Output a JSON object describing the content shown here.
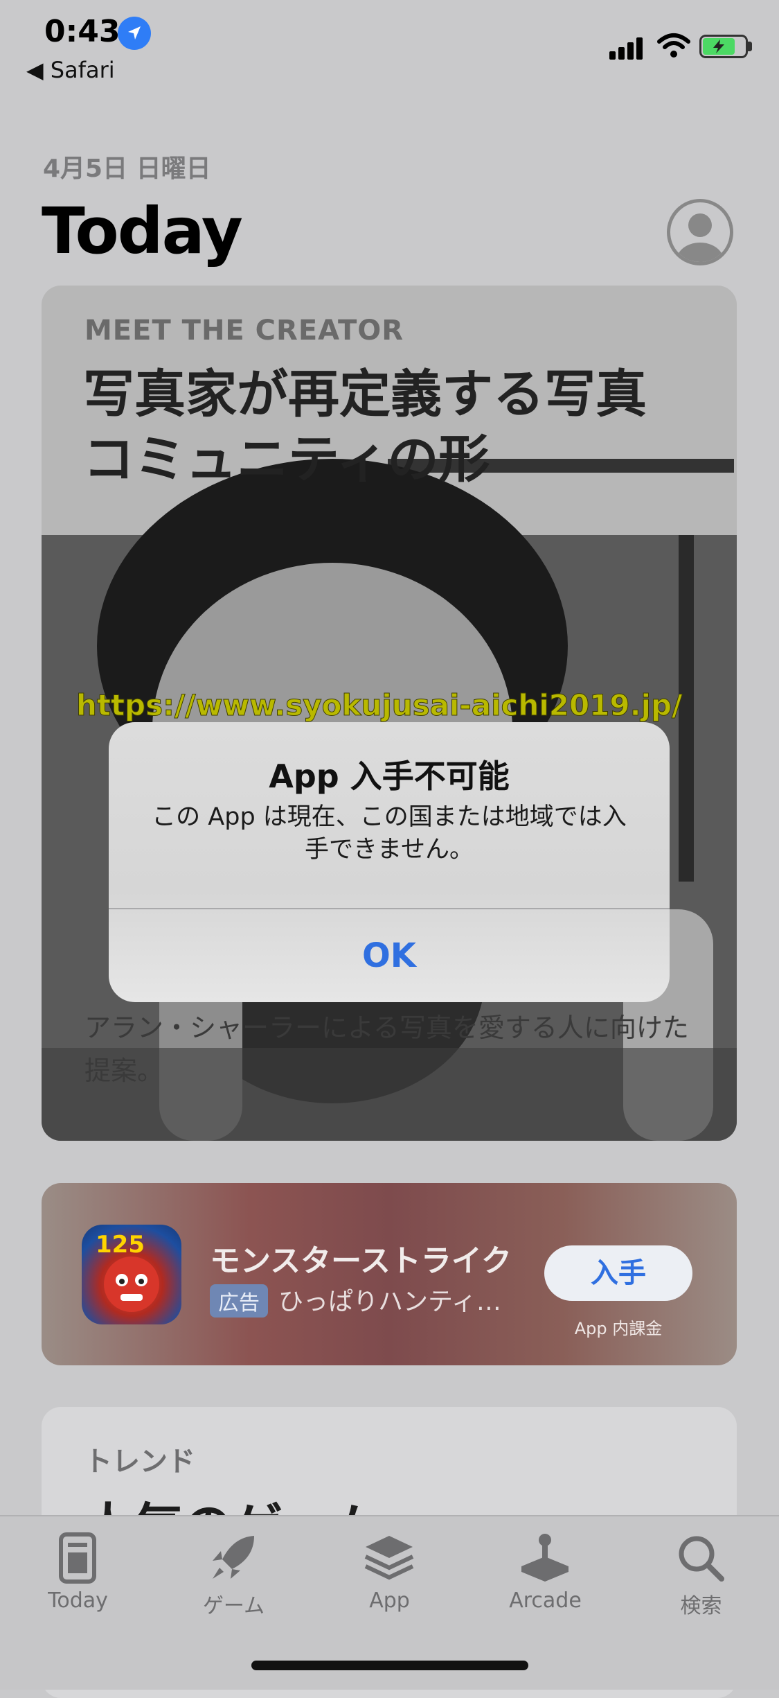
{
  "status_bar": {
    "time": "0:43",
    "back_label": "◀ Safari"
  },
  "header": {
    "date": "4月5日 日曜日",
    "title": "Today"
  },
  "story_card": {
    "label": "MEET THE CREATOR",
    "title": "写真家が再定義する写真コミュニティの形",
    "description": "アラン・シャーラーによる写真を愛する人に向けた提案。"
  },
  "watermark": "https://www.syokujusai-aichi2019.jp/",
  "alert": {
    "title": "App 入手不可能",
    "message": "この App は現在、この国または地域では入手できません。",
    "ok_label": "OK"
  },
  "ad_card": {
    "app_name": "モンスターストライク",
    "badge": "広告",
    "subtitle": "ひっぱりハンティ…",
    "get_label": "入手",
    "iap_label": "App 内課金"
  },
  "trend_card": {
    "label": "トレンド",
    "title": "人気のゲーム"
  },
  "tab_bar": {
    "items": [
      {
        "label": "Today",
        "icon": "today-icon"
      },
      {
        "label": "ゲーム",
        "icon": "rocket-icon"
      },
      {
        "label": "App",
        "icon": "app-stack-icon"
      },
      {
        "label": "Arcade",
        "icon": "joystick-icon"
      },
      {
        "label": "検索",
        "icon": "search-icon"
      }
    ]
  },
  "colors": {
    "accent": "#2f6fe0",
    "background": "#c9c9cb"
  }
}
